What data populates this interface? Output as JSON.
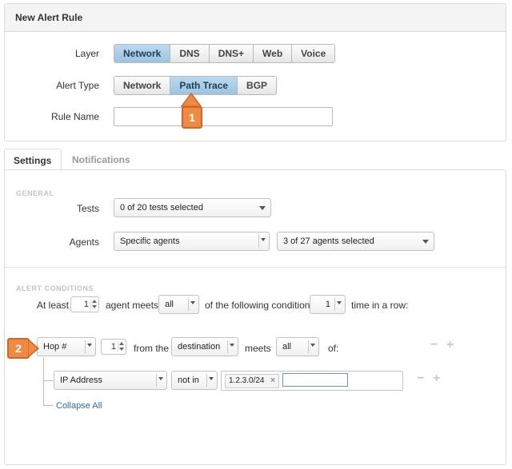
{
  "rule_panel": {
    "title": "New Alert Rule",
    "layer_label": "Layer",
    "layer_options": [
      "Network",
      "DNS",
      "DNS+",
      "Web",
      "Voice"
    ],
    "layer_selected": "Network",
    "alert_type_label": "Alert Type",
    "alert_type_options": [
      "Network",
      "Path Trace",
      "BGP"
    ],
    "alert_type_selected": "Path Trace",
    "rule_name_label": "Rule Name",
    "rule_name_value": "",
    "callout_1": "1"
  },
  "tabs": [
    {
      "label": "Settings",
      "active": true
    },
    {
      "label": "Notifications",
      "active": false
    }
  ],
  "general": {
    "section_label": "GENERAL",
    "tests_label": "Tests",
    "tests_value": "0 of 20 tests selected",
    "agents_label": "Agents",
    "agents_mode": "Specific agents",
    "agents_selected": "3 of 27 agents selected"
  },
  "alert_conditions": {
    "section_label": "ALERT CONDITIONS",
    "at_least_label": "At least",
    "agent_count": "1",
    "agent_meets_label": "agent meets",
    "meets_mode": "all",
    "following_label": "of the following conditions",
    "times_count": "1",
    "time_in_row_label": "time in a row:",
    "callout_2": "2",
    "condition": {
      "metric": "Hop #",
      "hop_value": "1",
      "from_the_label": "from the",
      "reference": "destination",
      "meets_label": "meets",
      "meets_mode": "all",
      "of_label": "of:"
    },
    "sub_condition": {
      "field": "IP Address",
      "operator": "not in",
      "tag": "1.2.3.0/24",
      "input_value": ""
    },
    "collapse_all": "Collapse All",
    "minus_symbol": "−",
    "plus_symbol": "+"
  },
  "colors": {
    "active_segment": "#9cc4e2",
    "callout": "#f08a43",
    "link": "#2a6db5"
  }
}
